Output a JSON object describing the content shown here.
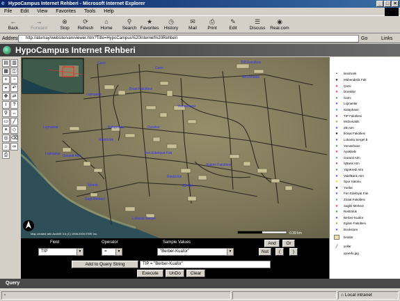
{
  "window": {
    "title": "HypoCampus Internet Rehberi - Microsoft Internet Explorer",
    "min": "_",
    "max": "□",
    "close": "×"
  },
  "menu": [
    "File",
    "Edit",
    "View",
    "Favorites",
    "Tools",
    "Help"
  ],
  "toolbar": [
    {
      "label": "Back",
      "icon": "←",
      "disabled": false
    },
    {
      "label": "Forward",
      "icon": "→",
      "disabled": true
    },
    {
      "label": "Stop",
      "icon": "⊗",
      "disabled": false
    },
    {
      "label": "Refresh",
      "icon": "⟳",
      "disabled": false
    },
    {
      "label": "Home",
      "icon": "⌂",
      "disabled": false
    },
    {
      "label": "Search",
      "icon": "⚲",
      "disabled": false
    },
    {
      "label": "Favorites",
      "icon": "★",
      "disabled": false
    },
    {
      "label": "History",
      "icon": "◷",
      "disabled": false
    },
    {
      "label": "Mail",
      "icon": "✉",
      "disabled": false
    },
    {
      "label": "Print",
      "icon": "⎙",
      "disabled": false
    },
    {
      "label": "Edit",
      "icon": "✎",
      "disabled": false
    },
    {
      "label": "Discuss",
      "icon": "☰",
      "disabled": false
    },
    {
      "label": "Real.com",
      "icon": "◉",
      "disabled": false
    }
  ],
  "address": {
    "label": "Address",
    "url": "http://atumay/website/van/viewer.htm?Title=HypoCampus%20Internet%20Rehberi",
    "go": "Go",
    "links": "Links"
  },
  "app": {
    "title": "HypoCampus Internet Rehberi"
  },
  "map": {
    "labels": [
      "Çarsi",
      "Cami",
      "TIP Fakültesi",
      "McDonalds",
      "Lojmanlar",
      "Ziraat Fakültesi",
      "Yemekhane",
      "Kütüphane",
      "Durakar",
      "Lojmanlar",
      "Rektörlük",
      "Lojmanlar",
      "Garanti Atm",
      "Fen Edebiyat Fak",
      "Egitim Fakültesi",
      "Rektörlük",
      "ZB Atm",
      "Sagl Merkezi",
      "Lokanta Sergel",
      "İşbank"
    ],
    "copyright": "Map created with ArcIMS 3.0   (C) 1998-2000 ESRI Inc.",
    "scale": "0.39 km",
    "north": "N"
  },
  "legend": {
    "header": "landmark",
    "items": [
      {
        "label": "Mühendislik Fak",
        "color": "#000000"
      },
      {
        "label": "Çarsi",
        "color": "#ff3030"
      },
      {
        "label": "Duraklar",
        "color": "#ff3030"
      },
      {
        "label": "Cami",
        "color": "#30a030"
      },
      {
        "label": "Lojmanlar",
        "color": "#3050ff"
      },
      {
        "label": "Kütüphane",
        "color": "#30a0a0"
      },
      {
        "label": "TIP Fakültesi",
        "color": "#a030a0"
      },
      {
        "label": "McDonalds",
        "color": "#a0a030"
      },
      {
        "label": "ZB Atm",
        "color": "#3050ff"
      },
      {
        "label": "İktisat Fakültesi",
        "color": "#000000"
      },
      {
        "label": "Lokanta Sergel B",
        "color": "#3050ff"
      },
      {
        "label": "Yemekhane",
        "color": "#30a030"
      },
      {
        "label": "Ayakkabı",
        "color": "#ff3030"
      },
      {
        "label": "Garanti Atm",
        "color": "#30a0a0"
      },
      {
        "label": "İşBank Atm",
        "color": "#a030a0"
      },
      {
        "label": "YapiKredi Atm",
        "color": "#30a030"
      },
      {
        "label": "VakifBank Atm",
        "color": "#3050ff"
      },
      {
        "label": "Spor Salonu",
        "color": "#ffd000"
      },
      {
        "label": "Yurtlar",
        "color": "#000000"
      },
      {
        "label": "Fen Edebiyat Fak",
        "color": "#3050ff"
      },
      {
        "label": "Ziraat Fakültesi",
        "color": "#30a0a0"
      },
      {
        "label": "Saglik Merkezi",
        "color": "#ff3030"
      },
      {
        "label": "Rektörlük",
        "color": "#30a030"
      },
      {
        "label": "Berber-Kuafor",
        "color": "#3050ff"
      },
      {
        "label": "Egitim Fakültesi",
        "color": "#a0a030"
      },
      {
        "label": "Bookstore",
        "color": "#3050ff"
      }
    ],
    "binalar": "binalar",
    "yollar": "yollar",
    "image": "yyuedu.jpg"
  },
  "query": {
    "field_label": "Field",
    "operator_label": "Operator",
    "sample_label": "Sample Values",
    "field_value": "TIP",
    "operator_value": "=",
    "sample_value": "\"Berber-Kuafor\"",
    "and": "And",
    "or": "Or",
    "not": "Not",
    "lparen": "(",
    "rparen": ")",
    "add": "Add to Query String",
    "expression": "TIP  =  \"Berber-Kuafor\"",
    "execute": "Execute",
    "undo": "UnDo",
    "clear": "Clear"
  },
  "querybar": {
    "label": "Query"
  },
  "status": {
    "zone": "Local intranet"
  }
}
